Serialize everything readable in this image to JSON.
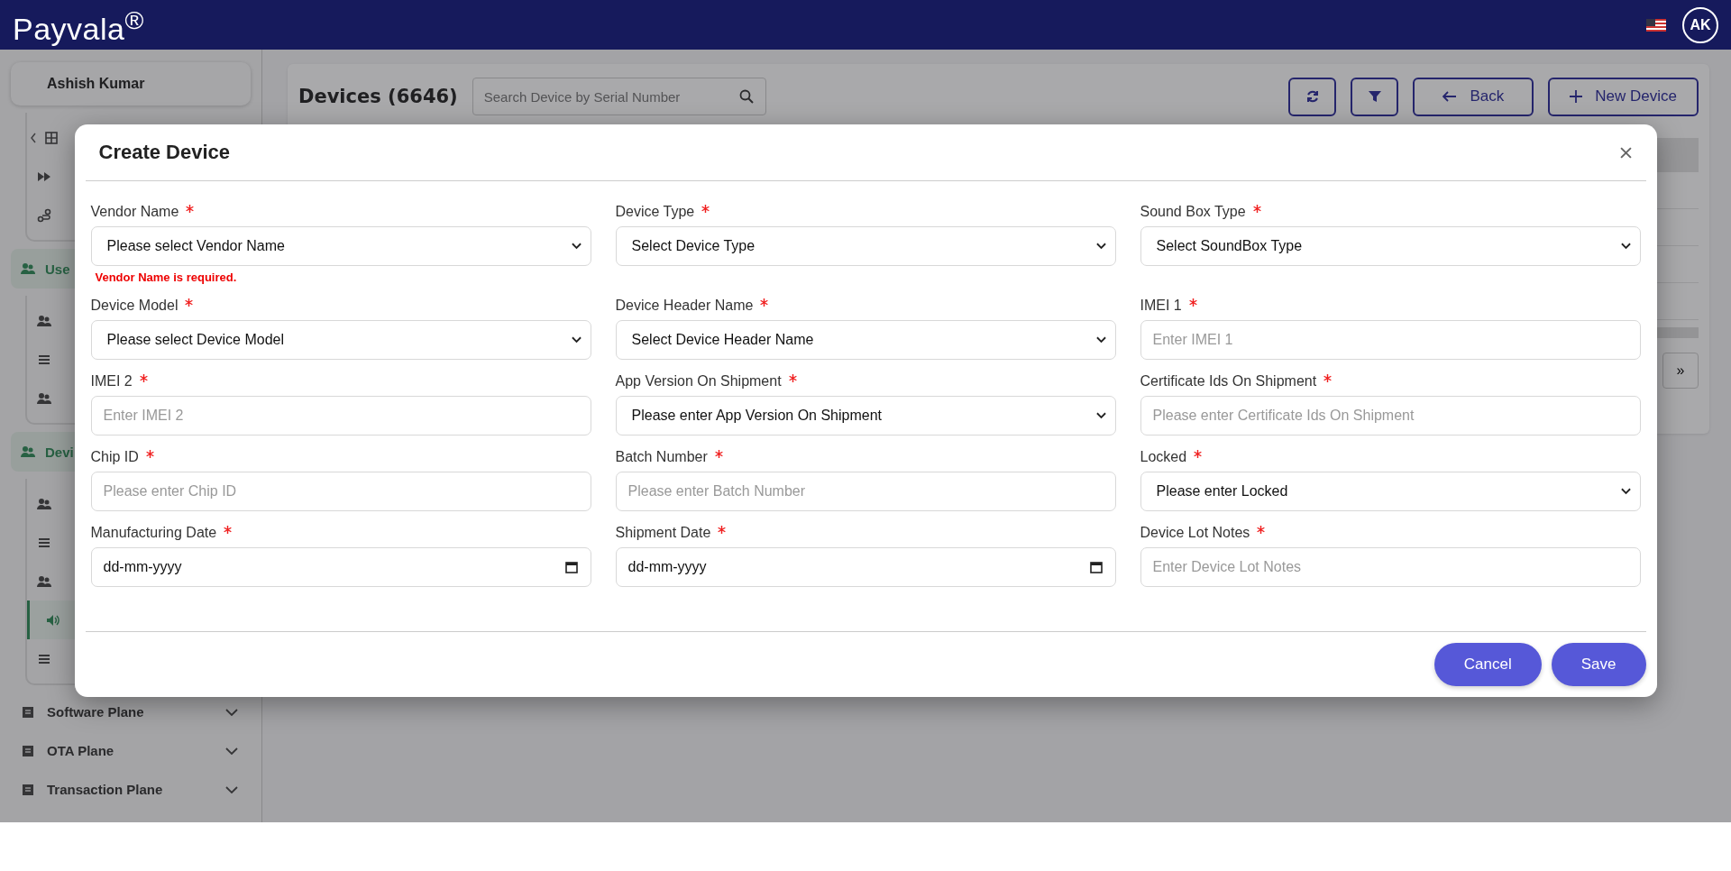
{
  "header": {
    "logo": "Payvala$^{®}$",
    "avatar": "AK"
  },
  "sidebar": {
    "user": "Ashish Kumar",
    "top_items": [
      {
        "selected": false
      },
      {
        "selected": false
      },
      {
        "selected": false
      }
    ],
    "sections": [
      {
        "label": "Use",
        "items": [
          {
            "selected": false
          },
          {
            "selected": false
          },
          {
            "selected": false
          }
        ]
      },
      {
        "label": "Devi",
        "items": [
          {
            "selected": false
          },
          {
            "selected": false
          },
          {
            "selected": false
          },
          {
            "selected": true
          },
          {
            "selected": false
          }
        ]
      }
    ],
    "planes": [
      {
        "label": "Software Plane"
      },
      {
        "label": "OTA Plane"
      },
      {
        "label": "Transaction Plane"
      }
    ]
  },
  "page": {
    "title": "Devices (6646)",
    "search": {
      "placeholder": "Search Device by Serial Number"
    },
    "back": "Back",
    "new_device": "New Device",
    "pager_next": "»"
  },
  "modal": {
    "title": "Create Device",
    "fields": [
      {
        "label": "Vendor Name",
        "required": true,
        "kind": "select",
        "value": "Please select Vendor Name",
        "error": "Vendor Name is required."
      },
      {
        "label": "Device Type",
        "required": true,
        "kind": "select",
        "value": "Select Device Type"
      },
      {
        "label": "Sound Box Type",
        "required": true,
        "kind": "select",
        "value": "Select SoundBox Type"
      },
      {
        "label": "Device Model",
        "required": true,
        "kind": "select",
        "value": "Please select Device Model"
      },
      {
        "label": "Device Header Name",
        "required": true,
        "kind": "select",
        "value": "Select Device Header Name"
      },
      {
        "label": "IMEI 1",
        "required": true,
        "kind": "text",
        "placeholder": "Enter IMEI 1"
      },
      {
        "label": "IMEI 2",
        "required": true,
        "kind": "text",
        "placeholder": "Enter IMEI 2"
      },
      {
        "label": "App Version On Shipment",
        "required": true,
        "kind": "select",
        "value": "Please enter App Version On Shipment"
      },
      {
        "label": "Certificate Ids On Shipment",
        "required": true,
        "kind": "text",
        "placeholder": "Please enter Certificate Ids On Shipment"
      },
      {
        "label": "Chip ID",
        "required": true,
        "kind": "text",
        "placeholder": "Please enter Chip ID"
      },
      {
        "label": "Batch Number",
        "required": true,
        "kind": "text",
        "placeholder": "Please enter Batch Number"
      },
      {
        "label": "Locked",
        "required": true,
        "kind": "select",
        "value": "Please enter Locked"
      },
      {
        "label": "Manufacturing Date",
        "required": true,
        "kind": "date",
        "value": "dd-mm-yyyy"
      },
      {
        "label": "Shipment Date",
        "required": true,
        "kind": "date",
        "value": "dd-mm-yyyy"
      },
      {
        "label": "Device Lot Notes",
        "required": true,
        "kind": "text",
        "placeholder": "Enter Device Lot Notes"
      }
    ],
    "buttons": [
      {
        "label": "Cancel"
      },
      {
        "label": "Save"
      }
    ]
  }
}
